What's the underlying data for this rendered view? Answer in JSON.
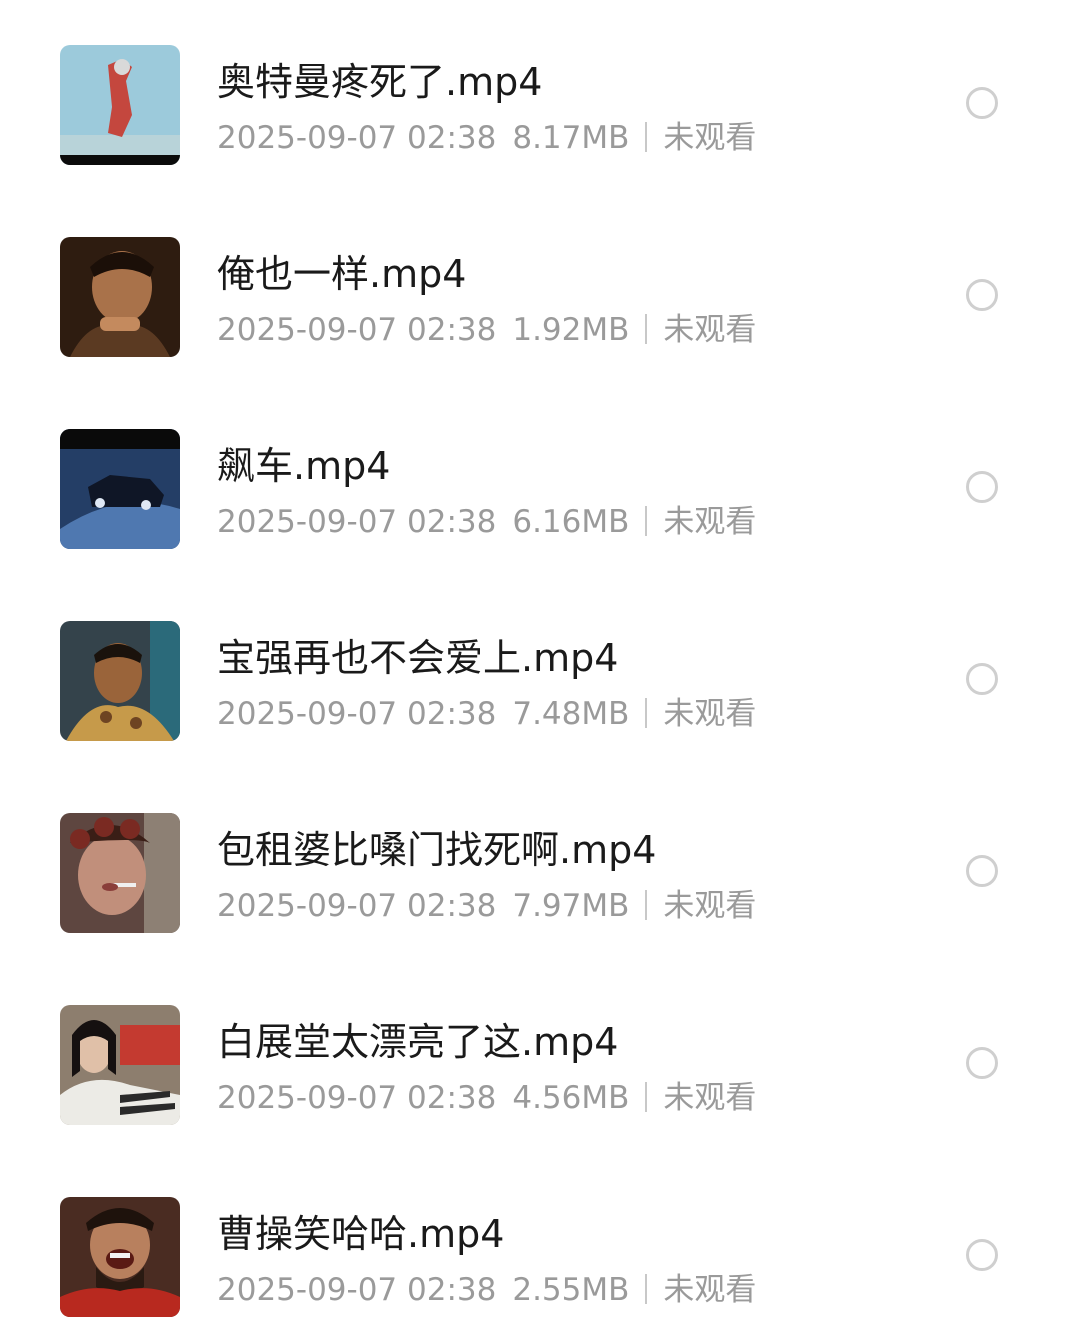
{
  "items": [
    {
      "title": "奥特曼疼死了.mp4",
      "datetime": "2025-09-07 02:38",
      "size": "8.17MB",
      "status": "未观看",
      "thumb_bg": "#8ebccc",
      "thumb_fg": "#c4473e"
    },
    {
      "title": "俺也一样.mp4",
      "datetime": "2025-09-07 02:38",
      "size": "1.92MB",
      "status": "未观看",
      "thumb_bg": "#3a2414",
      "thumb_fg": "#a9724a"
    },
    {
      "title": "飙车.mp4",
      "datetime": "2025-09-07 02:38",
      "size": "6.16MB",
      "status": "未观看",
      "thumb_bg": "#2a4d7c",
      "thumb_fg": "#111a2c"
    },
    {
      "title": "宝强再也不会爱上.mp4",
      "datetime": "2025-09-07 02:38",
      "size": "7.48MB",
      "status": "未观看",
      "thumb_bg": "#3b4a52",
      "thumb_fg": "#a06a3e"
    },
    {
      "title": "包租婆比嗓门找死啊.mp4",
      "datetime": "2025-09-07 02:38",
      "size": "7.97MB",
      "status": "未观看",
      "thumb_bg": "#6b4e48",
      "thumb_fg": "#c18f7b"
    },
    {
      "title": "白展堂太漂亮了这.mp4",
      "datetime": "2025-09-07 02:38",
      "size": "4.56MB",
      "status": "未观看",
      "thumb_bg": "#8a7a6a",
      "thumb_fg": "#e8e4dc"
    },
    {
      "title": "曹操笑哈哈.mp4",
      "datetime": "2025-09-07 02:38",
      "size": "2.55MB",
      "status": "未观看",
      "thumb_bg": "#5a3428",
      "thumb_fg": "#b8805e"
    }
  ]
}
